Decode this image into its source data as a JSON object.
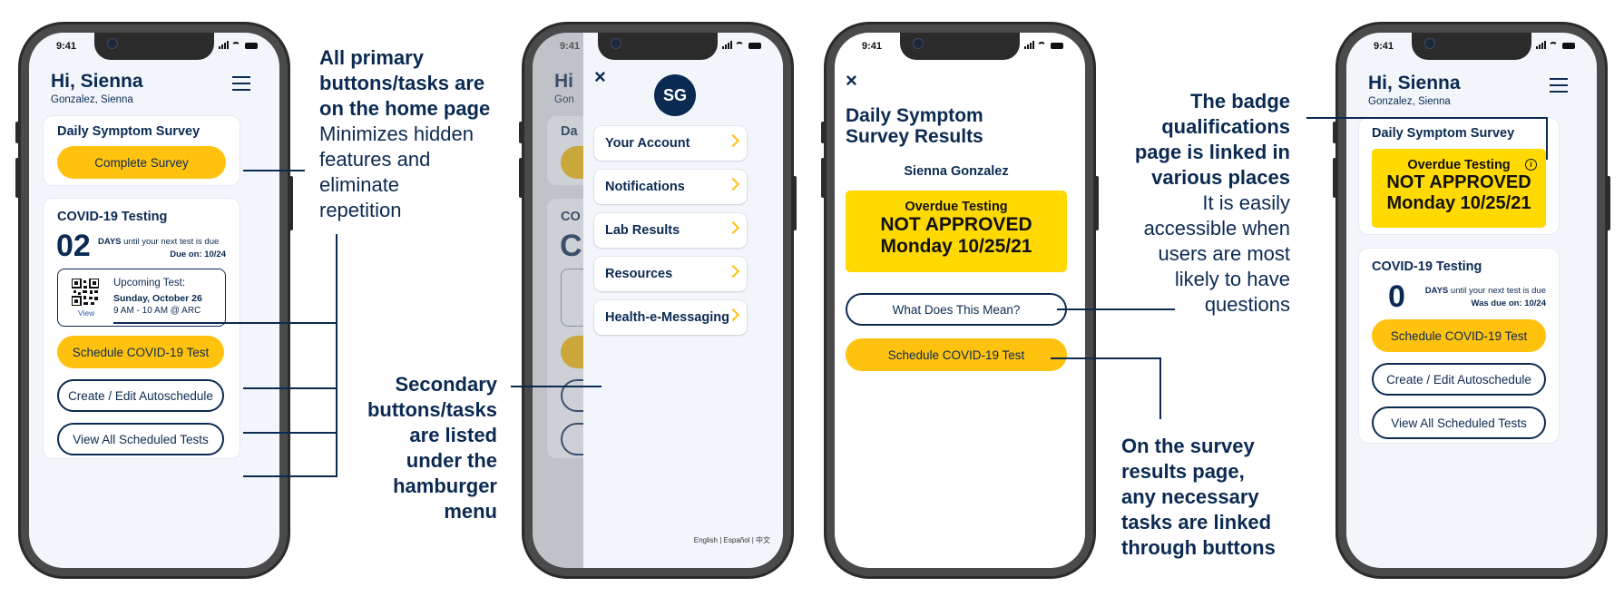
{
  "status": {
    "time": "9:41"
  },
  "home": {
    "greeting": "Hi, Sienna",
    "subname": "Gonzalez, Sienna",
    "survey_title": "Daily Symptom Survey",
    "complete_survey": "Complete Survey",
    "covid_title": "COVID-19 Testing",
    "days_num": "02",
    "days_label": "DAYS",
    "days_text": "until your next test is due",
    "due_label": "Due on: 10/24",
    "qr_view": "View",
    "upcoming_label": "Upcoming Test:",
    "upcoming_date": "Sunday, October 26",
    "upcoming_time": "9 AM - 10 AM @ ARC",
    "schedule_btn": "Schedule COVID-19 Test",
    "autoschedule_btn": "Create / Edit Autoschedule",
    "view_all_btn": "View All Scheduled Tests"
  },
  "menu": {
    "close": "×",
    "avatar_initials": "SG",
    "items": [
      "Your Account",
      "Notifications",
      "Lab Results",
      "Resources",
      "Health-e-Messaging"
    ],
    "lang_english": "English",
    "lang_espanol": "Español",
    "lang_chinese": "中文",
    "peek_hi": "Hi",
    "peek_gon": "Gon",
    "peek_da": "Da",
    "peek_co": "CO",
    "peek_c": "C"
  },
  "results": {
    "close": "×",
    "title_line1": "Daily Symptom",
    "title_line2": "Survey Results",
    "name": "Sienna Gonzalez",
    "badge_line1": "Overdue Testing",
    "badge_line2": "NOT APPROVED",
    "badge_line3": "Monday 10/25/21",
    "what_btn": "What Does This Mean?",
    "schedule_btn": "Schedule COVID-19 Test"
  },
  "home2": {
    "greeting": "Hi, Sienna",
    "subname": "Gonzalez, Sienna",
    "survey_title": "Daily Symptom Survey",
    "badge_line1": "Overdue Testing",
    "badge_line2": "NOT APPROVED",
    "badge_line3": "Monday 10/25/21",
    "info_icon": "i",
    "covid_title": "COVID-19 Testing",
    "days_num": "0",
    "days_label": "DAYS",
    "days_text": "until your next test is due",
    "due_label": "Was due on: 10/24",
    "schedule_btn": "Schedule COVID-19 Test",
    "autoschedule_btn": "Create / Edit Autoschedule",
    "view_all_btn": "View All Scheduled Tests"
  },
  "annotations": {
    "primary_bold": [
      "All primary",
      "buttons/tasks are",
      "on the home page"
    ],
    "primary_regular": [
      "Minimizes hidden",
      "features and",
      "eliminate",
      "repetition"
    ],
    "secondary_bold": [
      "Secondary",
      "buttons/tasks",
      "are listed",
      "under the",
      "hamburger",
      "menu"
    ],
    "badge_bold": [
      "The badge",
      "qualifications",
      "page is linked in",
      "various places"
    ],
    "badge_regular": [
      "It is easily",
      "accessible when",
      "users are most",
      "likely to have",
      "questions"
    ],
    "survey_bold": [
      "On the survey",
      "results page,",
      "any necessary",
      "tasks are linked",
      "through buttons"
    ]
  }
}
